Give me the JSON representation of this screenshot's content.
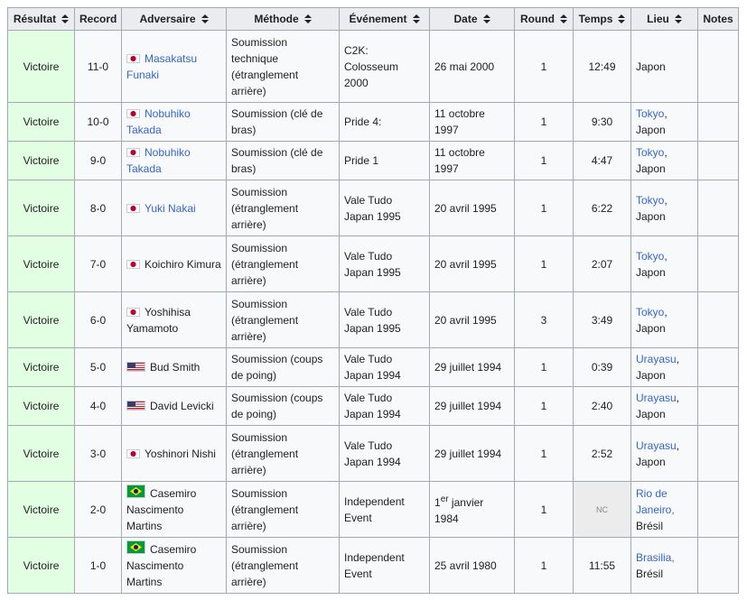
{
  "headers": {
    "resultat": "Résultat",
    "record": "Record",
    "adversaire": "Adversaire",
    "methode": "Méthode",
    "evenement": "Événement",
    "date": "Date",
    "round": "Round",
    "temps": "Temps",
    "lieu": "Lieu",
    "notes": "Notes"
  },
  "icons": {
    "sort": "sort-arrows-icon",
    "flags": [
      "japan-flag-icon",
      "usa-flag-icon",
      "brazil-flag-icon"
    ]
  },
  "colors": {
    "link": "#3366cc",
    "win_cell": "#e3ffe3",
    "header_bg": "#eaecf0",
    "border": "#a2a9b1"
  },
  "rows": [
    {
      "resultat": "Victoire",
      "record": "11-0",
      "adversaire": "Masakatsu Funaki",
      "methode": "Soumission technique (étranglement arrière)",
      "evenement": "C2K: Colosseum 2000",
      "date": "26 mai 2000",
      "round": "1",
      "temps": "12:49",
      "lieu_ville": "",
      "lieu_sep": "",
      "lieu_pays": "Japon",
      "notes": ""
    },
    {
      "resultat": "Victoire",
      "record": "10-0",
      "adversaire": "Nobuhiko Takada",
      "methode": "Soumission (clé de bras)",
      "evenement": "Pride 4:",
      "date": "11 octobre 1997",
      "round": "1",
      "temps": "9:30",
      "lieu_ville": "Tokyo",
      "lieu_sep": ",",
      "lieu_pays": "Japon",
      "notes": ""
    },
    {
      "resultat": "Victoire",
      "record": "9-0",
      "adversaire": "Nobuhiko Takada",
      "methode": "Soumission (clé de bras)",
      "evenement": "Pride 1",
      "date": "11 octobre 1997",
      "round": "1",
      "temps": "4:47",
      "lieu_ville": "Tokyo",
      "lieu_sep": ",",
      "lieu_pays": "Japon",
      "notes": ""
    },
    {
      "resultat": "Victoire",
      "record": "8-0",
      "adversaire": "Yuki Nakai",
      "methode": "Soumission (étranglement arrière)",
      "evenement": "Vale Tudo Japan 1995",
      "date": "20 avril 1995",
      "round": "1",
      "temps": "6:22",
      "lieu_ville": "Tokyo",
      "lieu_sep": ",",
      "lieu_pays": "Japon",
      "notes": ""
    },
    {
      "resultat": "Victoire",
      "record": "7-0",
      "adversaire": "Koichiro Kimura",
      "methode": "Soumission (étranglement arrière)",
      "evenement": "Vale Tudo Japan 1995",
      "date": "20 avril 1995",
      "round": "1",
      "temps": "2:07",
      "lieu_ville": "Tokyo",
      "lieu_sep": ",",
      "lieu_pays": "Japon",
      "notes": ""
    },
    {
      "resultat": "Victoire",
      "record": "6-0",
      "adversaire": "Yoshihisa Yamamoto",
      "methode": "Soumission (étranglement arrière)",
      "evenement": "Vale Tudo Japan 1995",
      "date": "20 avril 1995",
      "round": "3",
      "temps": "3:49",
      "lieu_ville": "Tokyo",
      "lieu_sep": ",",
      "lieu_pays": "Japon",
      "notes": ""
    },
    {
      "resultat": "Victoire",
      "record": "5-0",
      "adversaire": "Bud Smith",
      "methode": "Soumission (coups de poing)",
      "evenement": "Vale Tudo Japan 1994",
      "date": "29 juillet 1994",
      "round": "1",
      "temps": "0:39",
      "lieu_ville": "Urayasu",
      "lieu_sep": ",",
      "lieu_pays": "Japon",
      "notes": ""
    },
    {
      "resultat": "Victoire",
      "record": "4-0",
      "adversaire": "David Levicki",
      "methode": "Soumission (coups de poing)",
      "evenement": "Vale Tudo Japan 1994",
      "date": "29 juillet 1994",
      "round": "1",
      "temps": "2:40",
      "lieu_ville": "Urayasu",
      "lieu_sep": ",",
      "lieu_pays": "Japon",
      "notes": ""
    },
    {
      "resultat": "Victoire",
      "record": "3-0",
      "adversaire": "Yoshinori Nishi",
      "methode": "Soumission (étranglement arrière)",
      "evenement": "Vale Tudo Japan 1994",
      "date": "29 juillet 1994",
      "round": "1",
      "temps": "2:52",
      "lieu_ville": "Urayasu",
      "lieu_sep": ",",
      "lieu_pays": "Japon",
      "notes": ""
    },
    {
      "resultat": "Victoire",
      "record": "2-0",
      "adversaire": "Casemiro Nascimento Martins",
      "methode": "Soumission (étranglement arrière)",
      "evenement": "Independent Event",
      "date_num": "1",
      "date_sup": "er",
      "date": " janvier 1984",
      "round": "1",
      "temps": "NC",
      "lieu_ville": "Rio de Janeiro",
      "lieu_sep": ",",
      "lieu_pays": "Brésil",
      "notes": ""
    },
    {
      "resultat": "Victoire",
      "record": "1-0",
      "adversaire": "Casemiro Nascimento Martins",
      "methode": "Soumission (étranglement arrière)",
      "evenement": "Independent Event",
      "date": "25 avril 1980",
      "round": "1",
      "temps": "11:55",
      "lieu_ville": "Brasilia",
      "lieu_sep": ",",
      "lieu_pays": "Brésil",
      "notes": ""
    }
  ]
}
